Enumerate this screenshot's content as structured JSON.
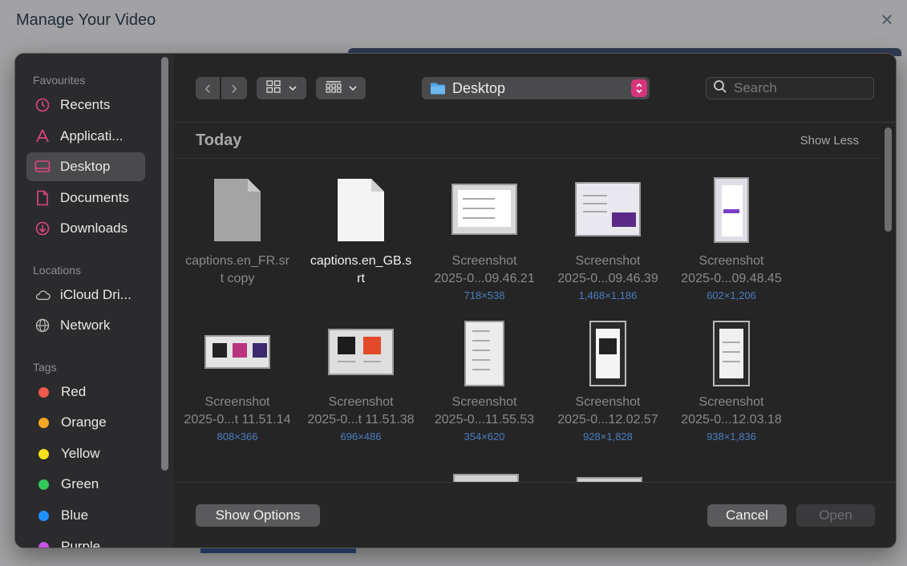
{
  "background": {
    "title": "Manage Your Video",
    "close_icon": "×"
  },
  "sidebar": {
    "favourites_heading": "Favourites",
    "favourites": [
      {
        "label": "Recents",
        "icon": "clock-icon"
      },
      {
        "label": "Applicati...",
        "icon": "applications-icon"
      },
      {
        "label": "Desktop",
        "icon": "desktop-icon",
        "selected": true
      },
      {
        "label": "Documents",
        "icon": "document-icon"
      },
      {
        "label": "Downloads",
        "icon": "download-icon"
      }
    ],
    "locations_heading": "Locations",
    "locations": [
      {
        "label": "iCloud Dri...",
        "icon": "cloud-icon"
      },
      {
        "label": "Network",
        "icon": "globe-icon"
      }
    ],
    "tags_heading": "Tags",
    "tags": [
      {
        "label": "Red",
        "color": "#f05a4a"
      },
      {
        "label": "Orange",
        "color": "#f5a623"
      },
      {
        "label": "Yellow",
        "color": "#f7e01b"
      },
      {
        "label": "Green",
        "color": "#34c759"
      },
      {
        "label": "Blue",
        "color": "#1e90ff"
      },
      {
        "label": "Purple",
        "color": "#c653e6"
      }
    ]
  },
  "toolbar": {
    "back_icon": "‹",
    "forward_icon": "›",
    "location": "Desktop",
    "search_placeholder": "Search"
  },
  "section": {
    "title": "Today",
    "toggle": "Show Less"
  },
  "files": [
    {
      "name_line1": "captions.en_FR.sr",
      "name_line2": "t copy",
      "dims": "",
      "kind": "doc"
    },
    {
      "name_line1": "captions.en_GB.s",
      "name_line2": "rt",
      "dims": "",
      "kind": "doc",
      "selected": true
    },
    {
      "name_line1": "Screenshot",
      "name_line2": "2025-0...09.46.21",
      "dims": "718×538",
      "kind": "shot"
    },
    {
      "name_line1": "Screenshot",
      "name_line2": "2025-0...09.46.39",
      "dims": "1,468×1,186",
      "kind": "shot"
    },
    {
      "name_line1": "Screenshot",
      "name_line2": "2025-0...09.48.45",
      "dims": "602×1,206",
      "kind": "shot"
    },
    {
      "name_line1": "Screenshot",
      "name_line2": "2025-0...t 11.51.14",
      "dims": "808×366",
      "kind": "shot"
    },
    {
      "name_line1": "Screenshot",
      "name_line2": "2025-0...t 11.51.38",
      "dims": "696×486",
      "kind": "shot"
    },
    {
      "name_line1": "Screenshot",
      "name_line2": "2025-0...11.55.53",
      "dims": "354×620",
      "kind": "shot"
    },
    {
      "name_line1": "Screenshot",
      "name_line2": "2025-0...12.02.57",
      "dims": "928×1,828",
      "kind": "shot"
    },
    {
      "name_line1": "Screenshot",
      "name_line2": "2025-0...12.03.18",
      "dims": "938×1,836",
      "kind": "shot"
    }
  ],
  "footer": {
    "options_label": "Show Options",
    "cancel_label": "Cancel",
    "open_label": "Open"
  },
  "colors": {
    "accent": "#d6357d",
    "dims_text": "#4a7ec0"
  }
}
